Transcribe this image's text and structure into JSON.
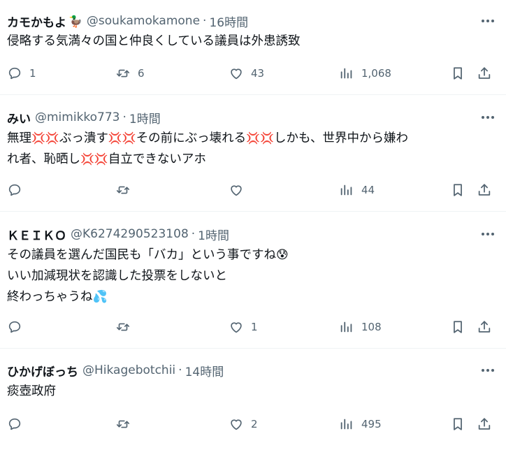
{
  "tweets": [
    {
      "name": "カモかもよ",
      "badge_icon": "duck-emoji-icon",
      "handle": "@soukamokamone",
      "sep": "·",
      "time": "16時間",
      "lines": [
        [
          {
            "t": "侵略する気満々の国と仲良くしている議員は外患誘致"
          }
        ]
      ],
      "replies": "1",
      "retweets": "6",
      "likes": "43",
      "views": "1,068"
    },
    {
      "name": "みい",
      "handle": "@mimikko773",
      "sep": "·",
      "time": "1時間",
      "lines": [
        [
          {
            "t": "無理"
          },
          {
            "e": "💢"
          },
          {
            "e": "💢"
          },
          {
            "t": "ぶっ潰す"
          },
          {
            "e": "💢"
          },
          {
            "e": "💢"
          },
          {
            "t": "その前にぶっ壊れる"
          },
          {
            "e": "💢"
          },
          {
            "e": "💢"
          },
          {
            "t": "しかも、世界中から嫌わ"
          }
        ],
        [
          {
            "t": "れ者、恥晒し"
          },
          {
            "e": "💢"
          },
          {
            "e": "💢"
          },
          {
            "t": "自立できないアホ"
          }
        ]
      ],
      "replies": "",
      "retweets": "",
      "likes": "",
      "views": "44"
    },
    {
      "name": "ＫＥＩＫＯ",
      "handle": "@K6274290523108",
      "sep": "·",
      "time": "1時間",
      "lines": [
        [
          {
            "t": "その議員を選んだ国民も「バカ」という事ですね"
          },
          {
            "e": "😰"
          }
        ],
        [
          {
            "t": "いい加減現状を認識した投票をしないと"
          }
        ],
        [
          {
            "t": "終わっちゃうね"
          },
          {
            "e": "💦"
          }
        ]
      ],
      "replies": "",
      "retweets": "",
      "likes": "1",
      "views": "108"
    },
    {
      "name": "ひかげぼっち",
      "handle": "@Hikagebotchii",
      "sep": "·",
      "time": "14時間",
      "lines": [
        [
          {
            "t": "痰壺政府"
          }
        ]
      ],
      "replies": "",
      "retweets": "",
      "likes": "2",
      "views": "495"
    }
  ],
  "colors": {
    "text": "#0f1419",
    "secondary": "#536471",
    "divider": "#eff3f4",
    "anger_emoji": "#e0245e"
  }
}
